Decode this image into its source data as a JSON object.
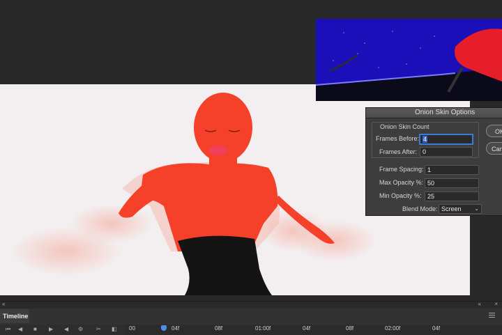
{
  "dialog": {
    "title": "Onion Skin Options",
    "group_title": "Onion Skin Count",
    "frames_before_label": "Frames Before:",
    "frames_before_value": "4",
    "frames_after_label": "Frames After:",
    "frames_after_value": "0",
    "frame_spacing_label": "Frame Spacing:",
    "frame_spacing_value": "1",
    "max_opacity_label": "Max Opacity %:",
    "max_opacity_value": "50",
    "min_opacity_label": "Min Opacity %:",
    "min_opacity_value": "25",
    "blend_mode_label": "Blend Mode:",
    "blend_mode_value": "Screen",
    "ok_label": "OK",
    "cancel_label": "Cancel"
  },
  "timeline": {
    "title": "Timeline",
    "ruler_labels": [
      "00",
      "04f",
      "08f",
      "01:00f",
      "04f",
      "08f",
      "02:00f",
      "04f"
    ]
  },
  "colors": {
    "figure": "#f5402a",
    "dress": "#141414",
    "canvas_bg": "#f3eff0",
    "preview_bg": "#1a0fb8",
    "playhead": "#4c8ee8"
  }
}
